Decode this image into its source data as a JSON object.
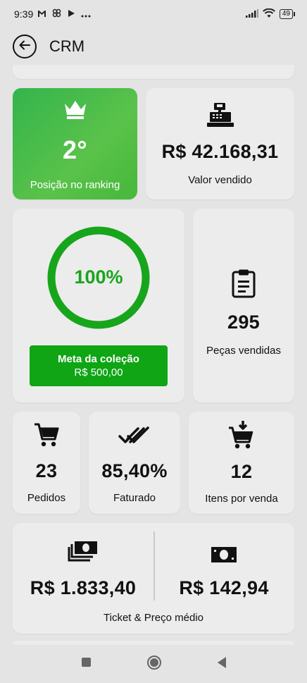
{
  "status_bar": {
    "time": "9:39",
    "battery": "49"
  },
  "app_bar": {
    "title": "CRM"
  },
  "ranking": {
    "value": "2°",
    "label": "Posição no ranking"
  },
  "sales_value": {
    "value": "R$ 42.168,31",
    "label": "Valor vendido"
  },
  "goal": {
    "percent": "100%",
    "progress": 1.0,
    "button_title": "Meta da coleção",
    "button_value": "R$ 500,00"
  },
  "pieces": {
    "value": "295",
    "label": "Peças vendidas"
  },
  "orders": {
    "value": "23",
    "label": "Pedidos"
  },
  "billed": {
    "value": "85,40%",
    "label": "Faturado"
  },
  "items_per_sale": {
    "value": "12",
    "label": "Itens por venda"
  },
  "ticket": {
    "left_value": "R$ 1.833,40",
    "right_value": "R$ 142,94",
    "label": "Ticket & Preço médio"
  },
  "colors": {
    "accent_green": "#0fa515",
    "ring_green": "#17a51c",
    "card_bg": "#ececec",
    "page_bg": "#e4e4e4"
  },
  "icons": [
    "gmail-icon",
    "pinwheel-icon",
    "play-icon",
    "more-icon",
    "signal-icon",
    "wifi-icon",
    "battery-icon",
    "back-arrow-icon",
    "crown-icon",
    "cash-register-icon",
    "clipboard-icon",
    "cart-icon",
    "double-check-icon",
    "cart-download-icon",
    "money-stack-icon",
    "money-icon"
  ]
}
